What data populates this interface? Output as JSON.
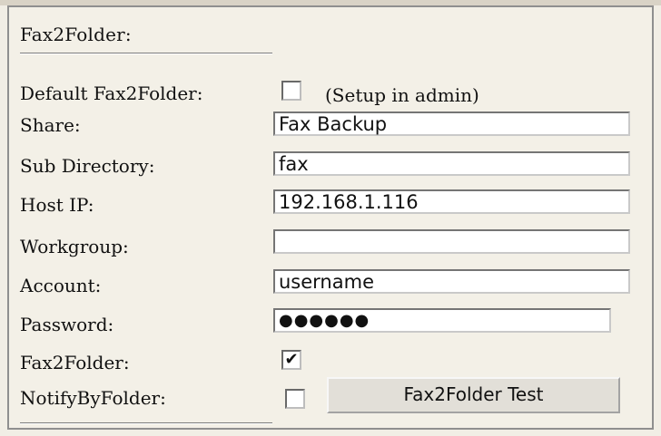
{
  "section": {
    "title": "Fax2Folder:"
  },
  "fields": {
    "default_label": "Default Fax2Folder:",
    "default_hint": "(Setup in admin)",
    "default_checked": false,
    "share_label": "Share:",
    "share_value": "Fax Backup",
    "subdir_label": "Sub Directory:",
    "subdir_value": "fax",
    "hostip_label": "Host IP:",
    "hostip_value": "192.168.1.116",
    "workgroup_label": "Workgroup:",
    "workgroup_value": "",
    "account_label": "Account:",
    "account_value": "username",
    "password_label": "Password:",
    "password_value": "●●●●●●",
    "fax2folder_label": "Fax2Folder:",
    "fax2folder_checked": true,
    "notify_label": "NotifyByFolder:",
    "notify_checked": false
  },
  "buttons": {
    "test_label": "Fax2Folder Test"
  },
  "icons": {
    "check_mark": "✔"
  }
}
